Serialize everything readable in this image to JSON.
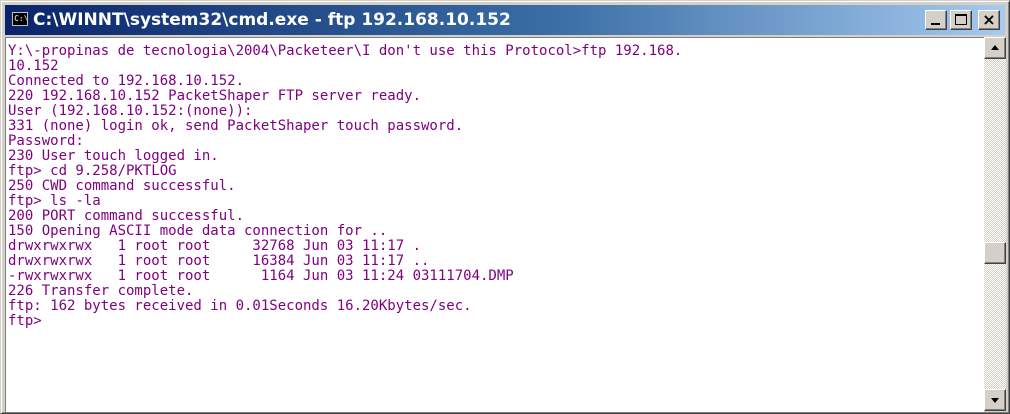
{
  "window": {
    "title": "C:\\WINNT\\system32\\cmd.exe - ftp 192.168.10.152",
    "icon_text": "C:\\"
  },
  "colors": {
    "console_text": "#800080",
    "console_bg": "#ffffff",
    "titlebar_start": "#0a246a",
    "titlebar_end": "#a6caf0"
  },
  "icons": [
    "cmd-app-icon",
    "minimize-icon",
    "maximize-icon",
    "close-icon",
    "scroll-up-arrow-icon",
    "scroll-down-arrow-icon"
  ],
  "console": {
    "lines": [
      "Y:\\-propinas de tecnologia\\2004\\Packeteer\\I don't use this Protocol>ftp 192.168.",
      "10.152",
      "Connected to 192.168.10.152.",
      "220 192.168.10.152 PacketShaper FTP server ready.",
      "User (192.168.10.152:(none)):",
      "331 (none) login ok, send PacketShaper touch password.",
      "Password:",
      "230 User touch logged in.",
      "ftp> cd 9.258/PKTLOG",
      "250 CWD command successful.",
      "ftp> ls -la",
      "200 PORT command successful.",
      "150 Opening ASCII mode data connection for ..",
      "drwxrwxrwx   1 root root     32768 Jun 03 11:17 .",
      "drwxrwxrwx   1 root root     16384 Jun 03 11:17 ..",
      "-rwxrwxrwx   1 root root      1164 Jun 03 11:24 03111704.DMP",
      "226 Transfer complete.",
      "ftp: 162 bytes received in 0.01Seconds 16.20Kbytes/sec.",
      "ftp>"
    ]
  }
}
